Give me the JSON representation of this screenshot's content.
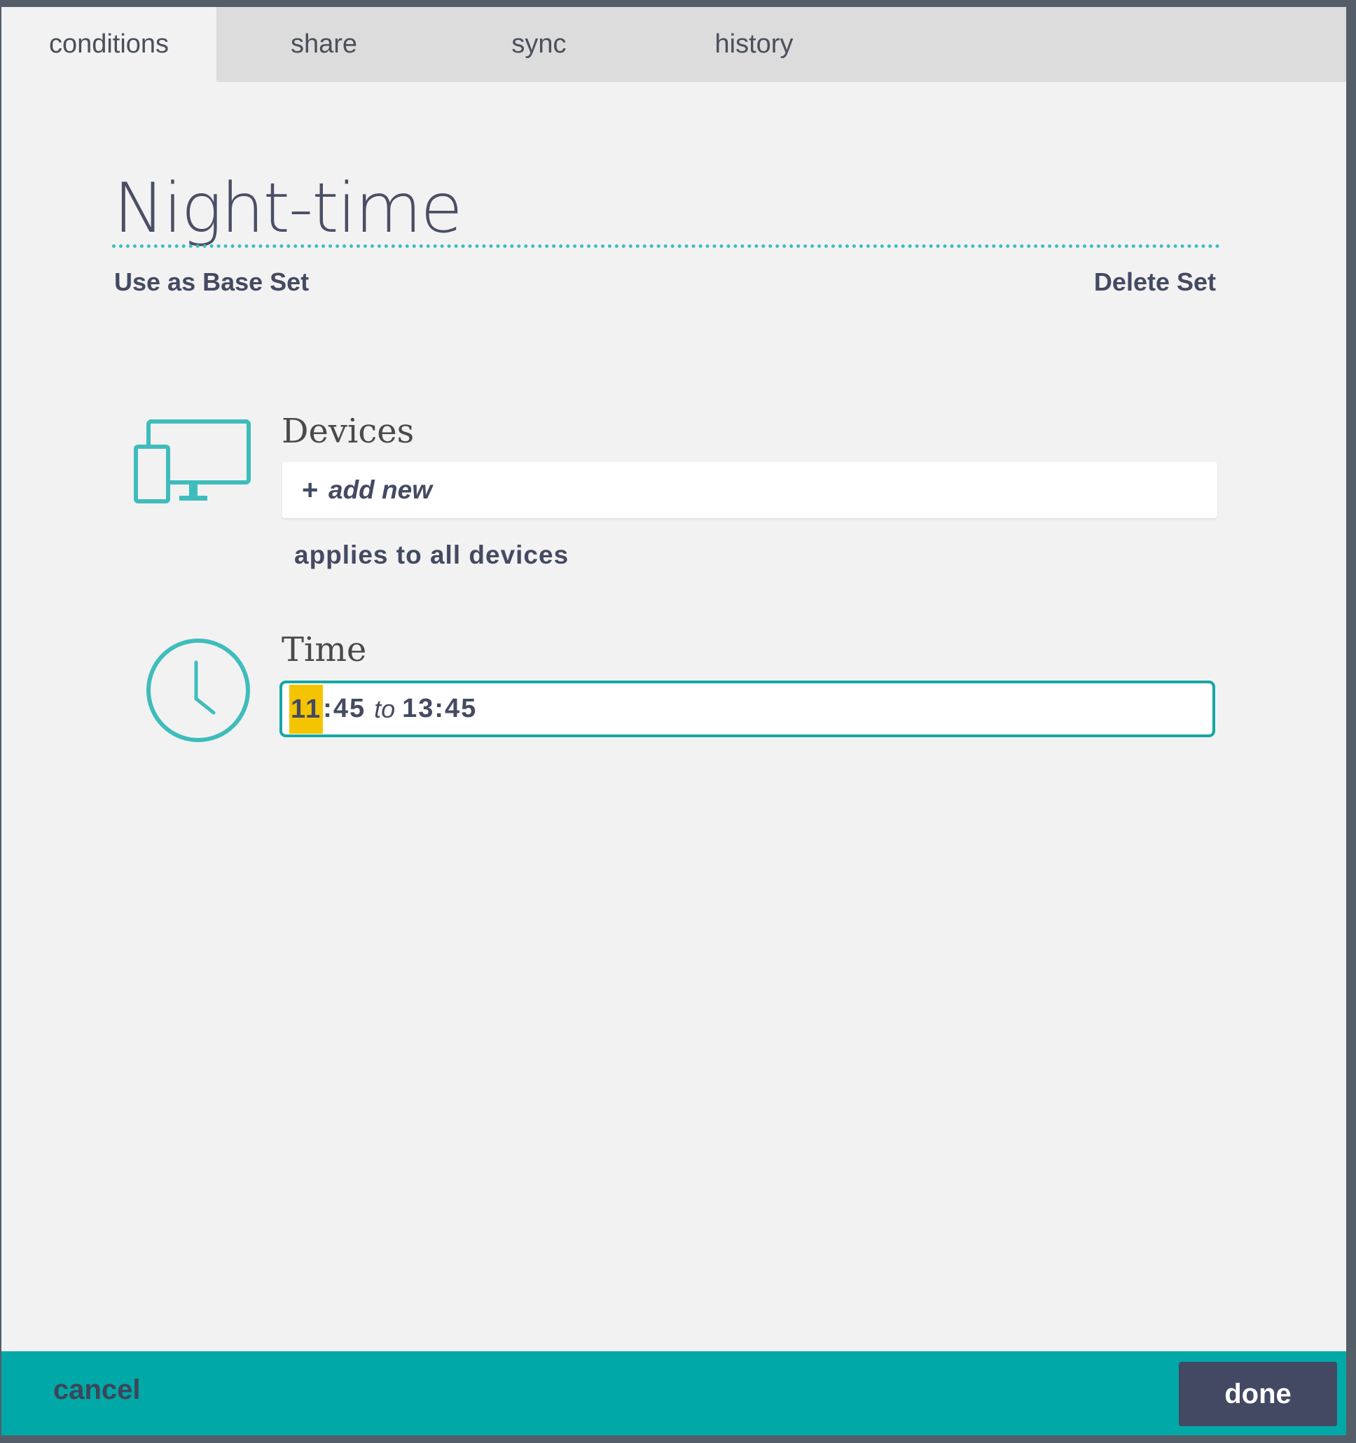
{
  "tabs": [
    {
      "label": "conditions",
      "active": true
    },
    {
      "label": "share",
      "active": false
    },
    {
      "label": "sync",
      "active": false
    },
    {
      "label": "history",
      "active": false
    }
  ],
  "set": {
    "title": "Night-time",
    "use_as_base_label": "Use as Base Set",
    "delete_label": "Delete Set"
  },
  "devices": {
    "heading": "Devices",
    "add_plus": "+",
    "add_label": "add new",
    "note": "applies to all devices",
    "icon": "devices-icon"
  },
  "time": {
    "heading": "Time",
    "start_selected": "11",
    "start_rest": ":45",
    "separator": "to",
    "end": "13:45",
    "icon": "clock-icon"
  },
  "footer": {
    "cancel_label": "cancel",
    "done_label": "done"
  },
  "colors": {
    "accent": "#00a8a8",
    "icon_teal": "#3fbcbc",
    "selection": "#f5c400",
    "dark_button": "#434863",
    "text_dark": "#444a62"
  }
}
